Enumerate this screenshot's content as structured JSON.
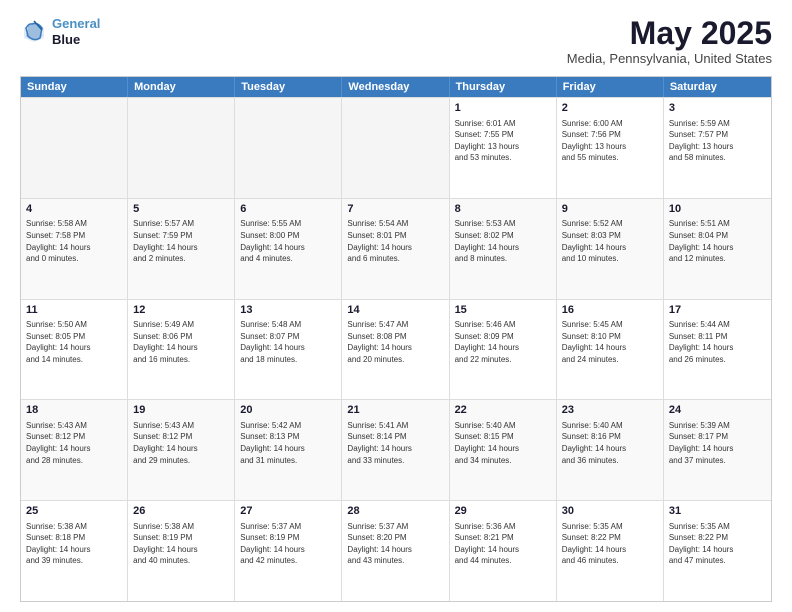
{
  "logo": {
    "line1": "General",
    "line2": "Blue"
  },
  "title": "May 2025",
  "subtitle": "Media, Pennsylvania, United States",
  "header": {
    "days": [
      "Sunday",
      "Monday",
      "Tuesday",
      "Wednesday",
      "Thursday",
      "Friday",
      "Saturday"
    ]
  },
  "weeks": [
    [
      {
        "day": "",
        "empty": true
      },
      {
        "day": "",
        "empty": true
      },
      {
        "day": "",
        "empty": true
      },
      {
        "day": "",
        "empty": true
      },
      {
        "day": "1",
        "info": "Sunrise: 6:01 AM\nSunset: 7:55 PM\nDaylight: 13 hours\nand 53 minutes."
      },
      {
        "day": "2",
        "info": "Sunrise: 6:00 AM\nSunset: 7:56 PM\nDaylight: 13 hours\nand 55 minutes."
      },
      {
        "day": "3",
        "info": "Sunrise: 5:59 AM\nSunset: 7:57 PM\nDaylight: 13 hours\nand 58 minutes."
      }
    ],
    [
      {
        "day": "4",
        "info": "Sunrise: 5:58 AM\nSunset: 7:58 PM\nDaylight: 14 hours\nand 0 minutes."
      },
      {
        "day": "5",
        "info": "Sunrise: 5:57 AM\nSunset: 7:59 PM\nDaylight: 14 hours\nand 2 minutes."
      },
      {
        "day": "6",
        "info": "Sunrise: 5:55 AM\nSunset: 8:00 PM\nDaylight: 14 hours\nand 4 minutes."
      },
      {
        "day": "7",
        "info": "Sunrise: 5:54 AM\nSunset: 8:01 PM\nDaylight: 14 hours\nand 6 minutes."
      },
      {
        "day": "8",
        "info": "Sunrise: 5:53 AM\nSunset: 8:02 PM\nDaylight: 14 hours\nand 8 minutes."
      },
      {
        "day": "9",
        "info": "Sunrise: 5:52 AM\nSunset: 8:03 PM\nDaylight: 14 hours\nand 10 minutes."
      },
      {
        "day": "10",
        "info": "Sunrise: 5:51 AM\nSunset: 8:04 PM\nDaylight: 14 hours\nand 12 minutes."
      }
    ],
    [
      {
        "day": "11",
        "info": "Sunrise: 5:50 AM\nSunset: 8:05 PM\nDaylight: 14 hours\nand 14 minutes."
      },
      {
        "day": "12",
        "info": "Sunrise: 5:49 AM\nSunset: 8:06 PM\nDaylight: 14 hours\nand 16 minutes."
      },
      {
        "day": "13",
        "info": "Sunrise: 5:48 AM\nSunset: 8:07 PM\nDaylight: 14 hours\nand 18 minutes."
      },
      {
        "day": "14",
        "info": "Sunrise: 5:47 AM\nSunset: 8:08 PM\nDaylight: 14 hours\nand 20 minutes."
      },
      {
        "day": "15",
        "info": "Sunrise: 5:46 AM\nSunset: 8:09 PM\nDaylight: 14 hours\nand 22 minutes."
      },
      {
        "day": "16",
        "info": "Sunrise: 5:45 AM\nSunset: 8:10 PM\nDaylight: 14 hours\nand 24 minutes."
      },
      {
        "day": "17",
        "info": "Sunrise: 5:44 AM\nSunset: 8:11 PM\nDaylight: 14 hours\nand 26 minutes."
      }
    ],
    [
      {
        "day": "18",
        "info": "Sunrise: 5:43 AM\nSunset: 8:12 PM\nDaylight: 14 hours\nand 28 minutes."
      },
      {
        "day": "19",
        "info": "Sunrise: 5:43 AM\nSunset: 8:12 PM\nDaylight: 14 hours\nand 29 minutes."
      },
      {
        "day": "20",
        "info": "Sunrise: 5:42 AM\nSunset: 8:13 PM\nDaylight: 14 hours\nand 31 minutes."
      },
      {
        "day": "21",
        "info": "Sunrise: 5:41 AM\nSunset: 8:14 PM\nDaylight: 14 hours\nand 33 minutes."
      },
      {
        "day": "22",
        "info": "Sunrise: 5:40 AM\nSunset: 8:15 PM\nDaylight: 14 hours\nand 34 minutes."
      },
      {
        "day": "23",
        "info": "Sunrise: 5:40 AM\nSunset: 8:16 PM\nDaylight: 14 hours\nand 36 minutes."
      },
      {
        "day": "24",
        "info": "Sunrise: 5:39 AM\nSunset: 8:17 PM\nDaylight: 14 hours\nand 37 minutes."
      }
    ],
    [
      {
        "day": "25",
        "info": "Sunrise: 5:38 AM\nSunset: 8:18 PM\nDaylight: 14 hours\nand 39 minutes."
      },
      {
        "day": "26",
        "info": "Sunrise: 5:38 AM\nSunset: 8:19 PM\nDaylight: 14 hours\nand 40 minutes."
      },
      {
        "day": "27",
        "info": "Sunrise: 5:37 AM\nSunset: 8:19 PM\nDaylight: 14 hours\nand 42 minutes."
      },
      {
        "day": "28",
        "info": "Sunrise: 5:37 AM\nSunset: 8:20 PM\nDaylight: 14 hours\nand 43 minutes."
      },
      {
        "day": "29",
        "info": "Sunrise: 5:36 AM\nSunset: 8:21 PM\nDaylight: 14 hours\nand 44 minutes."
      },
      {
        "day": "30",
        "info": "Sunrise: 5:35 AM\nSunset: 8:22 PM\nDaylight: 14 hours\nand 46 minutes."
      },
      {
        "day": "31",
        "info": "Sunrise: 5:35 AM\nSunset: 8:22 PM\nDaylight: 14 hours\nand 47 minutes."
      }
    ]
  ]
}
